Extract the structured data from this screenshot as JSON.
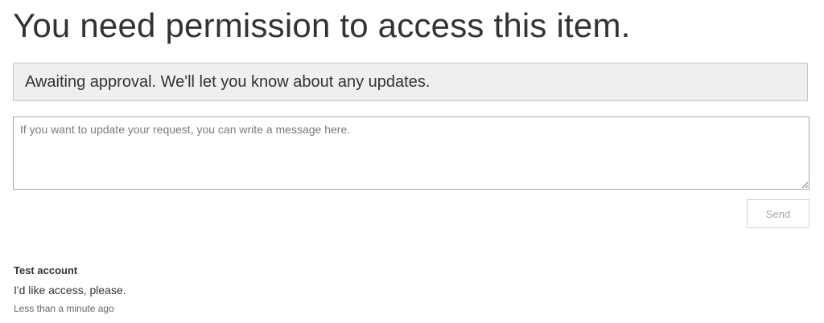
{
  "page": {
    "title": "You need permission to access this item."
  },
  "status": {
    "text": "Awaiting approval. We'll let you know about any updates."
  },
  "message": {
    "value": "",
    "placeholder": "If you want to update your request, you can write a message here."
  },
  "send_button": {
    "label": "Send"
  },
  "comment": {
    "author": "Test account",
    "body": "I'd like access, please.",
    "time": "Less than a minute ago"
  }
}
